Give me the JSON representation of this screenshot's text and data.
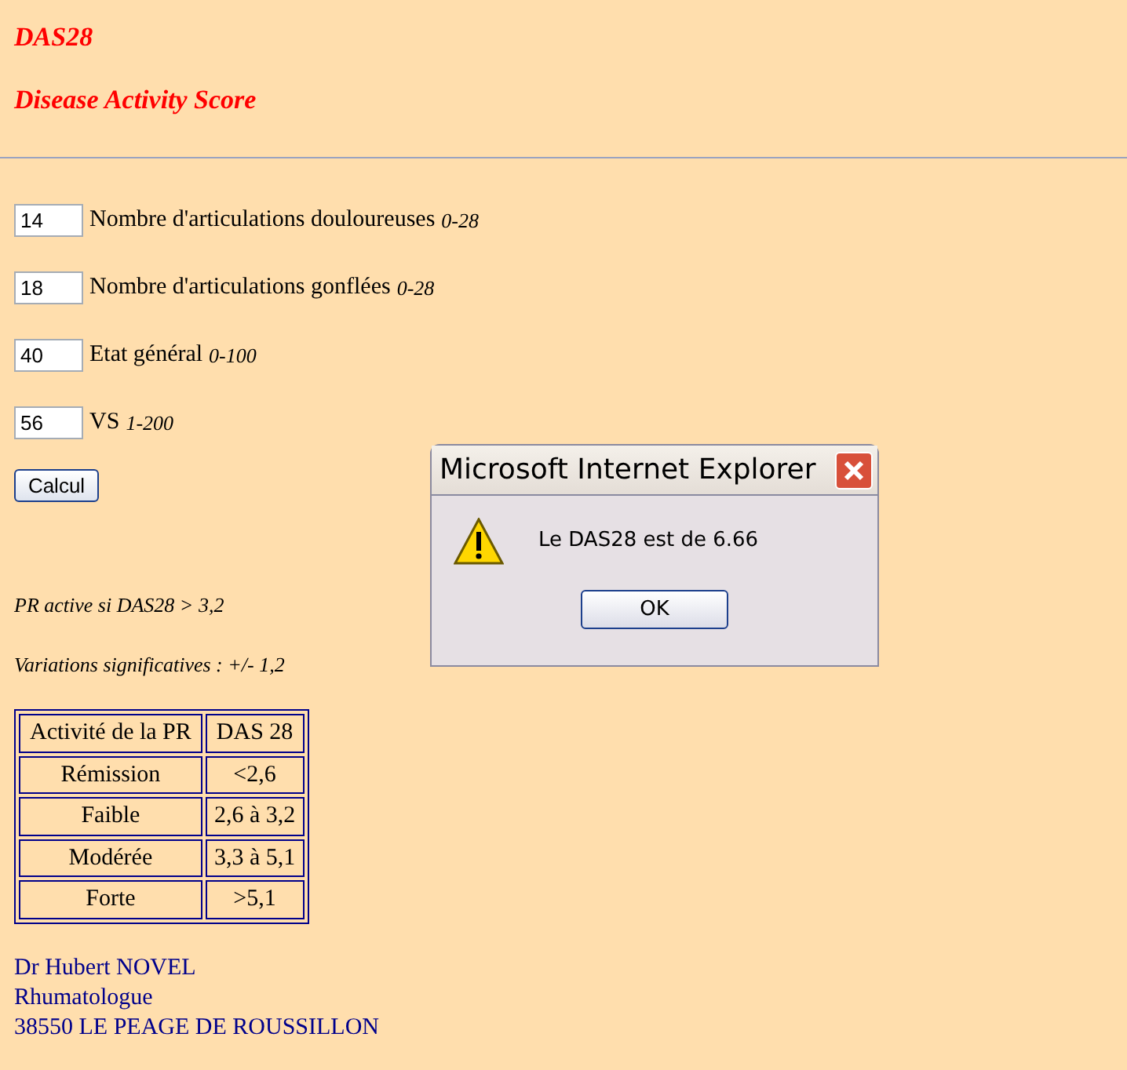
{
  "title": "DAS28",
  "subtitle": "Disease Activity Score",
  "fields": [
    {
      "value": "14",
      "label": "Nombre d'articulations douloureuses",
      "range": "0-28"
    },
    {
      "value": "18",
      "label": "Nombre d'articulations gonflées",
      "range": "0-28"
    },
    {
      "value": "40",
      "label": "Etat général",
      "range": "0-100"
    },
    {
      "value": "56",
      "label": "VS",
      "range": "1-200"
    }
  ],
  "button": "Calcul",
  "notes": [
    "PR active si DAS28 > 3,2",
    "Variations significatives : +/- 1,2"
  ],
  "table": {
    "columns": [
      "Activité de la PR",
      "DAS 28"
    ],
    "rows": [
      [
        "Rémission",
        "<2,6"
      ],
      [
        "Faible",
        "2,6 à 3,2"
      ],
      [
        "Modérée",
        "3,3 à 5,1"
      ],
      [
        "Forte",
        ">5,1"
      ]
    ]
  },
  "footer": [
    "Dr Hubert NOVEL",
    "Rhumatologue",
    "38550 LE PEAGE DE ROUSSILLON"
  ],
  "dialog": {
    "title": "Microsoft Internet Explorer",
    "message": "Le DAS28 est de 6.66",
    "button": "OK"
  }
}
